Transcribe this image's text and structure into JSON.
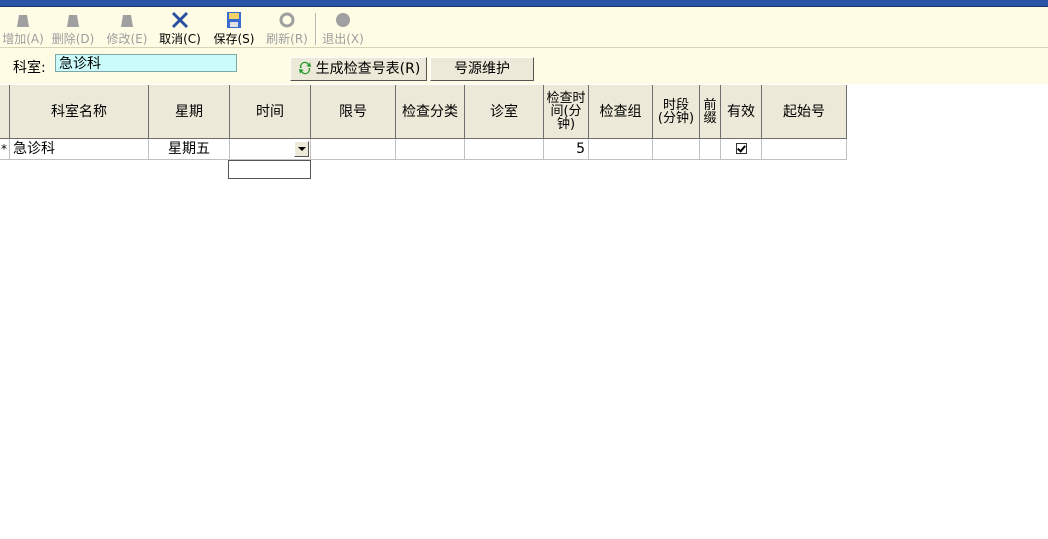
{
  "toolbar": {
    "add_label": "增加(A)",
    "delete_label": "删除(D)",
    "edit_label": "修改(E)",
    "cancel_label": "取消(C)",
    "save_label": "保存(S)",
    "refresh_label": "刷新(R)",
    "exit_label": "退出(X)"
  },
  "filter": {
    "label": "科室:",
    "value": "急诊科",
    "generate_button": "生成检查号表(R)",
    "maintain_button": "号源维护"
  },
  "table": {
    "columns": [
      "科室名称",
      "星期",
      "时间",
      "限号",
      "检查分类",
      "诊室",
      "检查时间(分钟)",
      "检查组",
      "时段(分钟)",
      "前缀",
      "有效",
      "起始号"
    ],
    "rows": [
      {
        "marker": "*",
        "dept": "急诊科",
        "weekday": "星期五",
        "time": "",
        "limit": "",
        "category": "",
        "room": "",
        "exam_minutes": "5",
        "group": "",
        "period": "",
        "prefix": "",
        "valid": true,
        "start_no": ""
      }
    ]
  },
  "colors": {
    "toolbar_bg": "#fffce6",
    "input_bg": "#ccfbfb",
    "header_bg": "#ece9d8"
  }
}
